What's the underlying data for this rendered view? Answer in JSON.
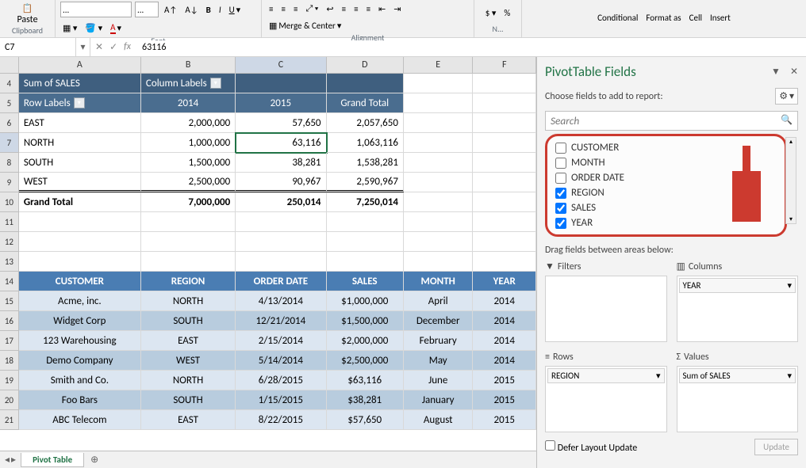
{
  "ribbon": {
    "paste_label": "Paste",
    "groups": {
      "clipboard": "Clipboard",
      "font": "Font",
      "alignment": "Alignment"
    },
    "font_name": "...",
    "font_size": "...",
    "merge_label": "Merge & Center",
    "number_label": "N...",
    "cond_label": "Conditional",
    "format_as_label": "Format as",
    "cell_label": "Cell",
    "insert_label": "Insert"
  },
  "formula_bar": {
    "name": "C7",
    "value": "63116"
  },
  "columns": [
    "A",
    "B",
    "C",
    "D",
    "E",
    "F"
  ],
  "active_col": "C",
  "rows_start": 4,
  "rows_end": 22,
  "active_row": 7,
  "pivot": {
    "sum_label": "Sum of SALES",
    "col_labels": "Column Labels",
    "row_labels": "Row Labels",
    "years": [
      "2014",
      "2015"
    ],
    "grand_total": "Grand Total",
    "rows": [
      {
        "label": "EAST",
        "v": [
          "2,000,000",
          "57,650",
          "2,057,650"
        ]
      },
      {
        "label": "NORTH",
        "v": [
          "1,000,000",
          "63,116",
          "1,063,116"
        ]
      },
      {
        "label": "SOUTH",
        "v": [
          "1,500,000",
          "38,281",
          "1,538,281"
        ]
      },
      {
        "label": "WEST",
        "v": [
          "2,500,000",
          "90,967",
          "2,590,967"
        ]
      }
    ],
    "totals": [
      "7,000,000",
      "250,014",
      "7,250,014"
    ]
  },
  "table": {
    "headers": [
      "CUSTOMER",
      "REGION",
      "ORDER DATE",
      "SALES",
      "MONTH",
      "YEAR"
    ],
    "rows": [
      [
        "Acme, inc.",
        "NORTH",
        "4/13/2014",
        "$1,000,000",
        "April",
        "2014"
      ],
      [
        "Widget Corp",
        "SOUTH",
        "12/21/2014",
        "$1,500,000",
        "December",
        "2014"
      ],
      [
        "123 Warehousing",
        "EAST",
        "2/15/2014",
        "$2,000,000",
        "February",
        "2014"
      ],
      [
        "Demo Company",
        "WEST",
        "5/14/2014",
        "$2,500,000",
        "May",
        "2014"
      ],
      [
        "Smith and Co.",
        "NORTH",
        "6/28/2015",
        "$63,116",
        "June",
        "2015"
      ],
      [
        "Foo Bars",
        "SOUTH",
        "1/15/2015",
        "$38,281",
        "January",
        "2015"
      ],
      [
        "ABC Telecom",
        "EAST",
        "8/22/2015",
        "$57,650",
        "August",
        "2015"
      ]
    ]
  },
  "tabs": {
    "active": "Pivot Table"
  },
  "pane": {
    "title": "PivotTable Fields",
    "choose": "Choose fields to add to report:",
    "search_placeholder": "Search",
    "fields": [
      {
        "name": "CUSTOMER",
        "checked": false
      },
      {
        "name": "MONTH",
        "checked": false
      },
      {
        "name": "ORDER DATE",
        "checked": false
      },
      {
        "name": "REGION",
        "checked": true
      },
      {
        "name": "SALES",
        "checked": true
      },
      {
        "name": "YEAR",
        "checked": true
      }
    ],
    "drag_label": "Drag fields between areas below:",
    "areas": {
      "filters": {
        "label": "Filters",
        "items": []
      },
      "columns": {
        "label": "Columns",
        "items": [
          "YEAR"
        ]
      },
      "rows": {
        "label": "Rows",
        "items": [
          "REGION"
        ]
      },
      "values": {
        "label": "Values",
        "items": [
          "Sum of SALES"
        ]
      }
    },
    "defer": "Defer Layout Update",
    "update": "Update"
  }
}
